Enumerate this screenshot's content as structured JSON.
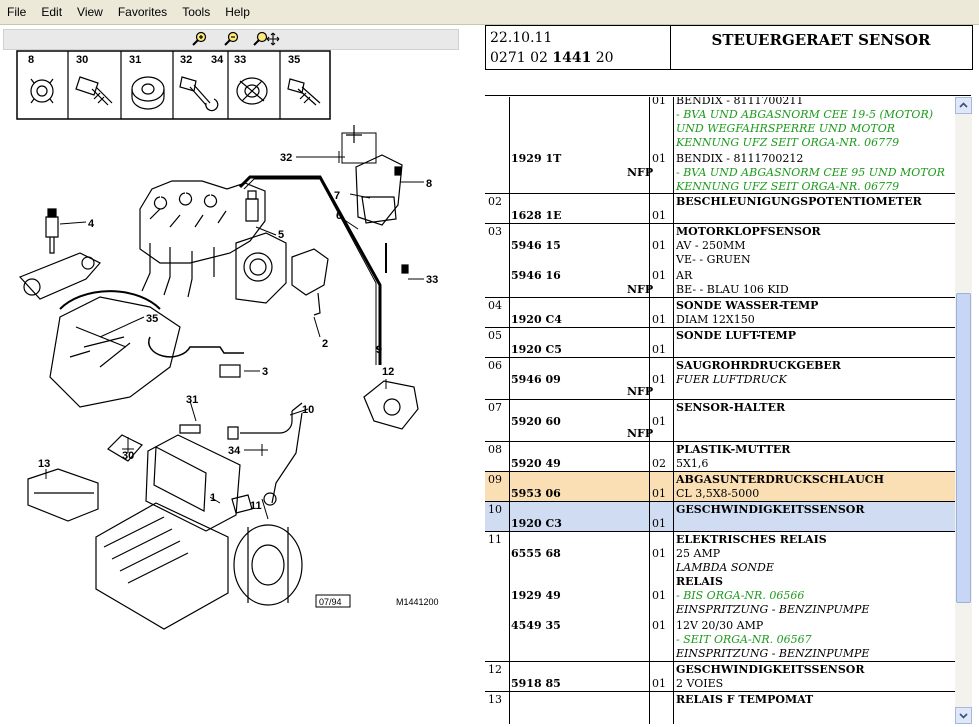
{
  "menu": [
    "File",
    "Edit",
    "View",
    "Favorites",
    "Tools",
    "Help"
  ],
  "toolbar": {
    "zoom_in": "zoom-in-icon",
    "zoom_out": "zoom-out-icon",
    "pan": "pan-zoom-icon"
  },
  "diagram": {
    "strip_labels": [
      "8",
      "30",
      "31",
      "32",
      "34",
      "33",
      "35"
    ],
    "callouts": [
      "32",
      "7",
      "8",
      "4",
      "5",
      "6",
      "33",
      "2",
      "9",
      "35",
      "3",
      "12",
      "31",
      "10",
      "13",
      "34",
      "30",
      "1",
      "11"
    ],
    "stamp_date": "07/94",
    "stamp_ref": "M1441200"
  },
  "header": {
    "date": "22.10.11",
    "part_prefix": "0271 02 ",
    "part_bold": "1441",
    "part_suffix": " 20",
    "title": "STEUERGERAET SENSOR"
  },
  "rows": {
    "r1": {
      "qty_a": "01",
      "desc_a": "BENDIX - 8111700211",
      "green_a": "- BVA UND ABGASNORM CEE 19-5 (MOTOR) UND WEGFAHRSPERRE UND MOTOR KENNUNG UFZ SEIT ORGA-NR. 06779",
      "ref_b": "1929 1T",
      "nfp_b": "NFP",
      "qty_b": "01",
      "desc_b": "BENDIX - 8111700212",
      "green_b": "- BVA UND ABGASNORM CEE 95 UND MOTOR KENNUNG UFZ SEIT ORGA-NR. 06779"
    },
    "r02": {
      "no": "02",
      "ref": "1628 1E",
      "qty": "01",
      "title": "BESCHLEUNIGUNGSPOTENTIOMETER"
    },
    "r03": {
      "no": "03",
      "title": "MOTORKLOPFSENSOR",
      "ref_a": "5946 15",
      "qty_a": "01",
      "d_a1": "AV - 250MM",
      "d_a2": "VE- - GRUEN",
      "ref_b": "5946 16",
      "qty_b": "01",
      "d_b1": "AR",
      "nfp": "NFP",
      "d_b2": "BE- - BLAU 106 KID"
    },
    "r04": {
      "no": "04",
      "title": "SONDE WASSER-TEMP",
      "ref": "1920 C4",
      "qty": "01",
      "desc": "DIAM 12X150"
    },
    "r05": {
      "no": "05",
      "title": "SONDE LUFT-TEMP",
      "ref": "1920 C5",
      "qty": "01"
    },
    "r06": {
      "no": "06",
      "title": "SAUGROHRDRUCKGEBER",
      "ref": "5946 09",
      "qty": "01",
      "desc": "FUER LUFTDRUCK",
      "nfp": "NFP"
    },
    "r07": {
      "no": "07",
      "title": "SENSOR-HALTER",
      "ref": "5920 60",
      "qty": "01",
      "nfp": "NFP"
    },
    "r08": {
      "no": "08",
      "title": "PLASTIK-MUTTER",
      "ref": "5920 49",
      "qty": "02",
      "desc": "5X1,6"
    },
    "r09": {
      "no": "09",
      "title": "ABGASUNTERDRUCKSCHLAUCH",
      "ref": "5953 06",
      "qty": "01",
      "desc": "CL 3,5X8-5000"
    },
    "r10": {
      "no": "10",
      "title": "GESCHWINDIGKEITSSENSOR",
      "ref": "1920 C3",
      "qty": "01"
    },
    "r11": {
      "no": "11",
      "title": "ELEKTRISCHES RELAIS",
      "ref_a": "6555 68",
      "qty_a": "01",
      "d_a1": "25 AMP",
      "d_a2": "LAMBDA SONDE",
      "title2": "RELAIS",
      "ref_b": "1929 49",
      "qty_b": "01",
      "green_b": "- BIS ORGA-NR. 06566",
      "d_b2": "EINSPRITZUNG - BENZINPUMPE",
      "ref_c": "4549 35",
      "qty_c": "01",
      "d_c1": "12V 20/30 AMP",
      "green_c": "- SEIT ORGA-NR. 06567",
      "d_c2": "EINSPRITZUNG - BENZINPUMPE"
    },
    "r12": {
      "no": "12",
      "title": "GESCHWINDIGKEITSSENSOR",
      "ref": "5918 85",
      "qty": "01",
      "desc": "2 VOIES"
    },
    "r13": {
      "no": "13",
      "title": "RELAIS F TEMPOMAT"
    }
  },
  "scrollbar": {
    "up": "scroll-up-arrow-icon",
    "down": "scroll-down-arrow-icon"
  }
}
